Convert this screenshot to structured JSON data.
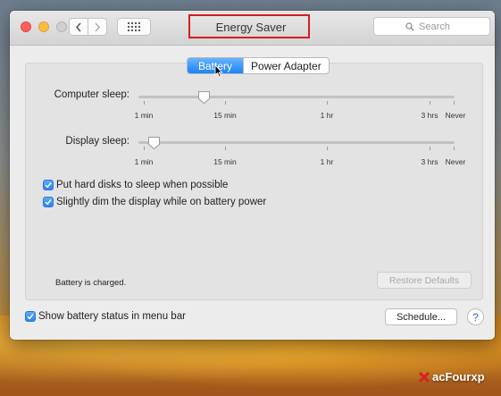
{
  "window": {
    "title": "Energy Saver",
    "search_placeholder": "Search"
  },
  "tabs": [
    {
      "label": "Battery",
      "selected": true
    },
    {
      "label": "Power Adapter",
      "selected": false
    }
  ],
  "sliders": {
    "computer_sleep": {
      "label": "Computer sleep:",
      "value": "15 min",
      "ticks": [
        "1 min",
        "15 min",
        "1 hr",
        "3 hrs",
        "Never"
      ]
    },
    "display_sleep": {
      "label": "Display sleep:",
      "value": "2 min",
      "ticks": [
        "1 min",
        "15 min",
        "1 hr",
        "3 hrs",
        "Never"
      ]
    }
  },
  "options": [
    {
      "label": "Put hard disks to sleep when possible",
      "checked": true
    },
    {
      "label": "Slightly dim the display while on battery power",
      "checked": true
    }
  ],
  "status_text": "Battery is charged.",
  "restore_label": "Restore Defaults",
  "menu_bar_option": {
    "label": "Show battery status in menu bar",
    "checked": true
  },
  "schedule_label": "Schedule...",
  "help_label": "?",
  "watermark": {
    "text": "acFourxp"
  },
  "colors": {
    "accent": "#1a82fb",
    "highlight_box": "#d81c1c"
  }
}
